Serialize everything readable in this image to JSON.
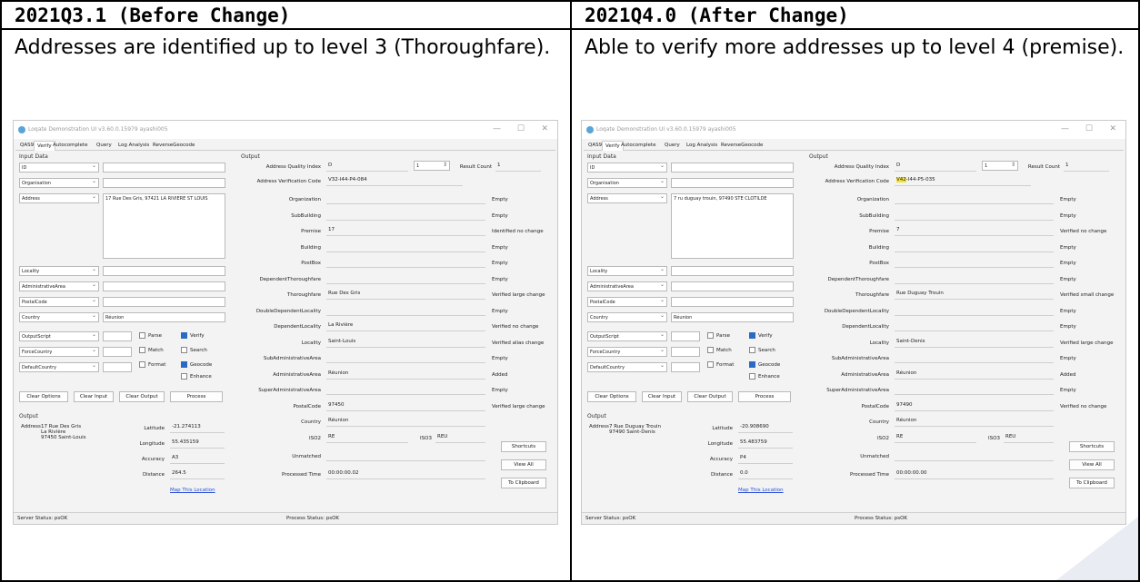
{
  "left": {
    "header": "2021Q3.1 (Before Change)",
    "description": "Addresses are identified up to level 3 (Thoroughfare).",
    "app": {
      "title": "Loqate Demonstration UI v3.60.0.15979 ayashi005",
      "tabs": [
        "QAS9",
        "Verify",
        "Autocomplete",
        "Query",
        "Log Analysis",
        "ReverseGeocode"
      ],
      "active_tab": "Verify",
      "input_group": "Input Data",
      "input_rows": [
        "ID",
        "Organisation",
        "Address"
      ],
      "address_value": "17 Rue Des Gris, 97421 LA RIVIERE ST LOUIS",
      "input_rows2": [
        "Locality",
        "AdministrativeArea",
        "PostalCode",
        "Country"
      ],
      "country_value": "Réunion",
      "option_rows": [
        "OutputScript",
        "ForceCountry",
        "DefaultCountry"
      ],
      "checkboxes": [
        {
          "label": "Parse",
          "on": false
        },
        {
          "label": "Verify",
          "on": true
        },
        {
          "label": "Match",
          "on": false
        },
        {
          "label": "Search",
          "on": false
        },
        {
          "label": "Format",
          "on": false
        },
        {
          "label": "Geocode",
          "on": true
        },
        {
          "label": "Enhance",
          "on": false
        }
      ],
      "buttons": [
        "Clear Options",
        "Clear Input",
        "Clear Output",
        "Process"
      ],
      "output_group": "Output",
      "output_address_label": "Address",
      "output_address": "17 Rue Des Gris\nLa Rivière\n97450 Saint-Louis",
      "geo_labels": [
        "Latitude",
        "Longitude",
        "Accuracy",
        "Distance"
      ],
      "geo_values": [
        "-21.274113",
        "55.435159",
        "A3",
        "264.5"
      ],
      "map_link": "Map This Location",
      "right_output_group": "Output",
      "aqi_label": "Address Quality Index",
      "aqi_value": "D",
      "spin_value": "1",
      "result_count_label": "Result Count",
      "result_count": "1",
      "avc_label": "Address Verification Code",
      "avc_value": "V32-I44-P4-084",
      "fields": [
        {
          "label": "Organization",
          "value": "",
          "status": "Empty"
        },
        {
          "label": "SubBuilding",
          "value": "",
          "status": "Empty"
        },
        {
          "label": "Premise",
          "value": "17",
          "status": "Identified no change"
        },
        {
          "label": "Building",
          "value": "",
          "status": "Empty"
        },
        {
          "label": "PostBox",
          "value": "",
          "status": "Empty"
        },
        {
          "label": "DependentThoroughfare",
          "value": "",
          "status": "Empty"
        },
        {
          "label": "Thoroughfare",
          "value": "Rue Des Gris",
          "status": "Verified large change"
        },
        {
          "label": "DoubleDependentLocality",
          "value": "",
          "status": "Empty"
        },
        {
          "label": "DependentLocality",
          "value": "La Rivière",
          "status": "Verified no change"
        },
        {
          "label": "Locality",
          "value": "Saint-Louis",
          "status": "Verified alias change"
        },
        {
          "label": "SubAdministrativeArea",
          "value": "",
          "status": "Empty"
        },
        {
          "label": "AdministrativeArea",
          "value": "Réunion",
          "status": "Added"
        },
        {
          "label": "SuperAdministrativeArea",
          "value": "",
          "status": "Empty"
        },
        {
          "label": "PostalCode",
          "value": "97450",
          "status": "Verified large change"
        },
        {
          "label": "Country",
          "value": "Réunion",
          "status": ""
        }
      ],
      "iso2_label": "ISO2",
      "iso2_value": "RE",
      "iso3_label": "ISO3",
      "iso3_value": "REU",
      "unmatched_label": "Unmatched",
      "processed_label": "Processed Time",
      "processed_value": "00:00:00.02",
      "side_buttons": [
        "Shortcuts",
        "View All",
        "To Clipboard"
      ],
      "server_status": "Server Status: psOK",
      "process_status": "Process Status: psOK"
    }
  },
  "right": {
    "header": "2021Q4.0 (After Change)",
    "description": "Able to verify more addresses up to level 4 (premise).",
    "app": {
      "title": "Loqate Demonstration UI v3.60.0.15979 ayashi005",
      "tabs": [
        "QAS9",
        "Verify",
        "Autocomplete",
        "Query",
        "Log Analysis",
        "ReverseGeocode"
      ],
      "active_tab": "Verify",
      "input_group": "Input Data",
      "input_rows": [
        "ID",
        "Organisation",
        "Address"
      ],
      "address_value": "7 ru duguay trouin, 97490 STE CLOTILDE",
      "input_rows2": [
        "Locality",
        "AdministrativeArea",
        "PostalCode",
        "Country"
      ],
      "country_value": "Réunion",
      "option_rows": [
        "OutputScript",
        "ForceCountry",
        "DefaultCountry"
      ],
      "checkboxes": [
        {
          "label": "Parse",
          "on": false
        },
        {
          "label": "Verify",
          "on": true
        },
        {
          "label": "Match",
          "on": false
        },
        {
          "label": "Search",
          "on": false
        },
        {
          "label": "Format",
          "on": false
        },
        {
          "label": "Geocode",
          "on": true
        },
        {
          "label": "Enhance",
          "on": false
        }
      ],
      "buttons": [
        "Clear Options",
        "Clear Input",
        "Clear Output",
        "Process"
      ],
      "output_group": "Output",
      "output_address_label": "Address",
      "output_address": "7 Rue Duguay Trouin\n97490 Saint-Denis",
      "geo_labels": [
        "Latitude",
        "Longitude",
        "Accuracy",
        "Distance"
      ],
      "geo_values": [
        "-20.908690",
        "55.483759",
        "P4",
        "0.0"
      ],
      "map_link": "Map This Location",
      "right_output_group": "Output",
      "aqi_label": "Address Quality Index",
      "aqi_value": "D",
      "spin_value": "1",
      "result_count_label": "Result Count",
      "result_count": "1",
      "avc_label": "Address Verification Code",
      "avc_highlight": "V42",
      "avc_value": "-I44-P5-035",
      "fields": [
        {
          "label": "Organization",
          "value": "",
          "status": "Empty"
        },
        {
          "label": "SubBuilding",
          "value": "",
          "status": "Empty"
        },
        {
          "label": "Premise",
          "value": "7",
          "status": "Verified no change"
        },
        {
          "label": "Building",
          "value": "",
          "status": "Empty"
        },
        {
          "label": "PostBox",
          "value": "",
          "status": "Empty"
        },
        {
          "label": "DependentThoroughfare",
          "value": "",
          "status": "Empty"
        },
        {
          "label": "Thoroughfare",
          "value": "Rue Duguay Trouin",
          "status": "Verified small change"
        },
        {
          "label": "DoubleDependentLocality",
          "value": "",
          "status": "Empty"
        },
        {
          "label": "DependentLocality",
          "value": "",
          "status": "Empty"
        },
        {
          "label": "Locality",
          "value": "Saint-Denis",
          "status": "Verified large change"
        },
        {
          "label": "SubAdministrativeArea",
          "value": "",
          "status": "Empty"
        },
        {
          "label": "AdministrativeArea",
          "value": "Réunion",
          "status": "Added"
        },
        {
          "label": "SuperAdministrativeArea",
          "value": "",
          "status": "Empty"
        },
        {
          "label": "PostalCode",
          "value": "97490",
          "status": "Verified no change"
        },
        {
          "label": "Country",
          "value": "Réunion",
          "status": ""
        }
      ],
      "iso2_label": "ISO2",
      "iso2_value": "RE",
      "iso3_label": "ISO3",
      "iso3_value": "REU",
      "unmatched_label": "Unmatched",
      "processed_label": "Processed Time",
      "processed_value": "00:00:00.00",
      "side_buttons": [
        "Shortcuts",
        "View All",
        "To Clipboard"
      ],
      "server_status": "Server Status: psOK",
      "process_status": "Process Status: psOK"
    }
  }
}
